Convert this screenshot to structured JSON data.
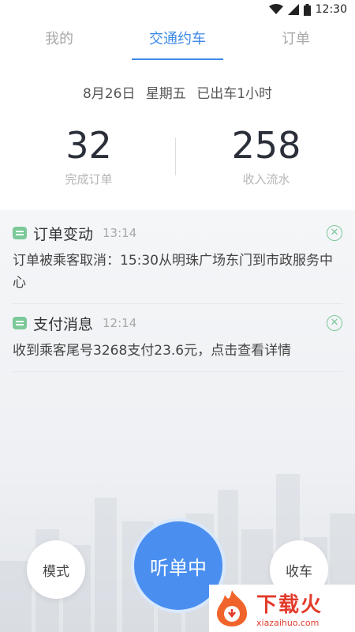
{
  "status_bar": {
    "time": "12:30",
    "icons": [
      "wifi-icon",
      "signal-icon",
      "battery-icon"
    ]
  },
  "tabs": [
    {
      "label": "我的",
      "active": false
    },
    {
      "label": "交通约车",
      "active": true
    },
    {
      "label": "订单",
      "active": false
    }
  ],
  "summary": {
    "date_line": "8月26日 星期五 已出车1小时",
    "stats": [
      {
        "value": "32",
        "label": "完成订单"
      },
      {
        "value": "258",
        "label": "收入流水"
      }
    ]
  },
  "messages": [
    {
      "title": "订单变动",
      "time": "13:14",
      "body": "订单被乘客取消：15:30从明珠广场东门到市政服务中心"
    },
    {
      "title": "支付消息",
      "time": "12:14",
      "body": "收到乘客尾号3268支付23.6元，点击查看详情"
    }
  ],
  "controls": {
    "mode_label": "模式",
    "main_label": "听单中",
    "stop_label": "收车"
  },
  "watermark": {
    "name": "下载火",
    "url": "xiazaihuo.com"
  },
  "colors": {
    "accent": "#3e8ae6",
    "main_button": "#4a8ff0",
    "message_icon": "#7cc99a",
    "brand": "#e23b2b"
  }
}
